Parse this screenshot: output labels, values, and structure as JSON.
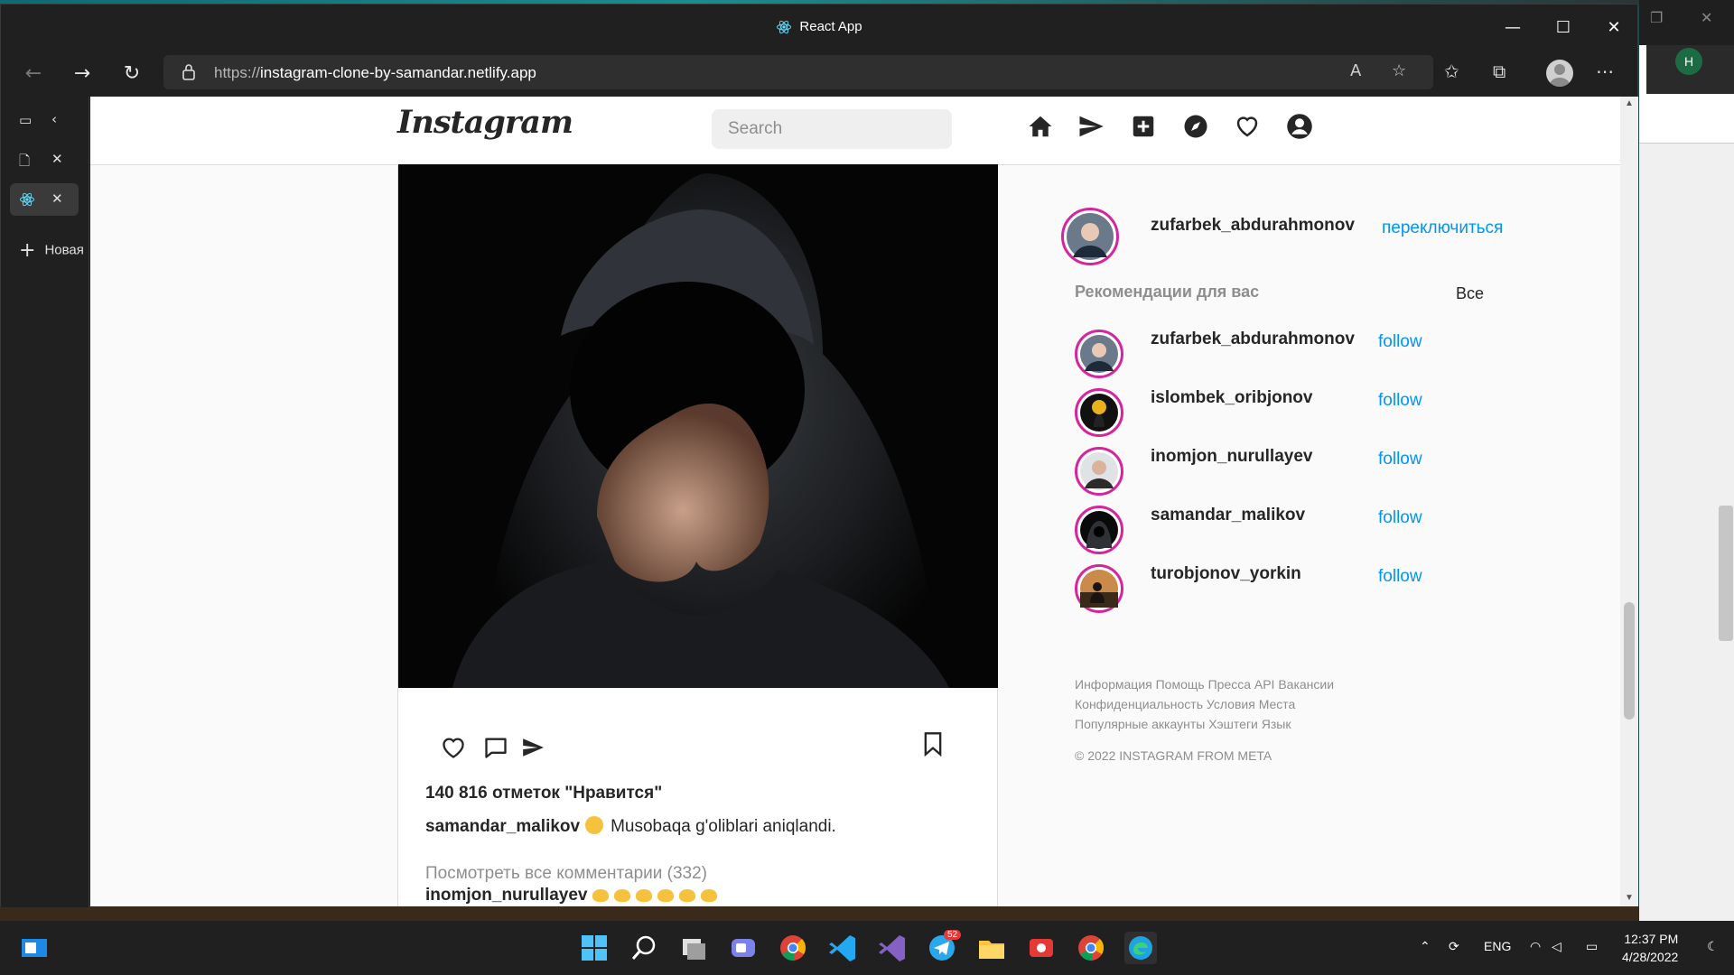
{
  "browser": {
    "title": "React App",
    "url_prefix": "https://",
    "url_host": "instagram-clone-by-samandar.netlify.app",
    "sidebar_new_tab": "Новая"
  },
  "instagram": {
    "logo": "Instagram",
    "search_placeholder": "Search",
    "post": {
      "likes": "140 816 отметок \"Нравится\"",
      "caption_user": "samandar_malikov",
      "caption_text": "Musobaqa g'oliblari aniqlandi.",
      "view_comments": "Посмотреть все комментарии (332)",
      "first_comment_user": "inomjon_nurullayev"
    },
    "current_user": {
      "username": "zufarbek_abdurahmonov",
      "switch_label": "переключиться"
    },
    "suggestions_title": "Рекомендации для вас",
    "see_all": "Все",
    "suggestions": [
      {
        "username": "zufarbek_abdurahmonov",
        "action": "follow"
      },
      {
        "username": "islombek_oribjonov",
        "action": "follow"
      },
      {
        "username": "inomjon_nurullayev",
        "action": "follow"
      },
      {
        "username": "samandar_malikov",
        "action": "follow"
      },
      {
        "username": "turobjonov_yorkin",
        "action": "follow"
      }
    ],
    "footer": {
      "line1": "Информация Помощь Пресса API Вакансии",
      "line2": "Конфиденциальность Условия Места",
      "line3": "Популярные аккаунты Хэштеги Язык",
      "copyright": "© 2022 INSTAGRAM FROM META"
    }
  },
  "taskbar": {
    "language": "ENG",
    "time": "12:37 PM",
    "date": "4/28/2022",
    "telegram_badge": "52"
  },
  "colors": {
    "link_blue": "#0095f6",
    "story_ring": "#d6249f",
    "browser_dark": "#202020"
  }
}
